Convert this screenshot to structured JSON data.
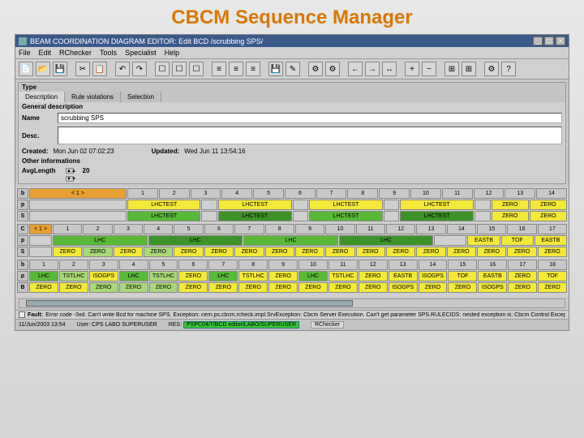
{
  "slide_title": "CBCM Sequence Manager",
  "window": {
    "title": "BEAM COORDINATION DIAGRAM EDITOR:  Edit BCD /scrubbing SPS/",
    "minimize": "_",
    "maximize": "□",
    "close": "×"
  },
  "menubar": [
    "File",
    "Edit",
    "RChecker",
    "Tools",
    "Specialist",
    "Help"
  ],
  "toolbar_icons": [
    "📄",
    "📂",
    "💾",
    "",
    "✂",
    "📋",
    "",
    "↶",
    "↷",
    "",
    "☐",
    "☐",
    "☐",
    "",
    "≡",
    "≡",
    "≡",
    "",
    "💾",
    "✎",
    "",
    "⚙",
    "⚙",
    "",
    "←",
    "→",
    "↔",
    "",
    "+",
    "−",
    "",
    "⊞",
    "⊞",
    "",
    "⚙",
    "?"
  ],
  "type_panel": {
    "header": "Type",
    "tabs": [
      "Description",
      "Rule violations",
      "Selection"
    ],
    "gen_desc": "General description",
    "name_lbl": "Name",
    "name_val": "scrubbing SPS",
    "desc_lbl": "Desc.",
    "desc_val": "",
    "created_lbl": "Created:",
    "created_val": "Mon Jun 02 07:02:23",
    "updated_lbl": "Updated:",
    "updated_val": "Wed Jun 11 13:54:16",
    "other_info": "Other informations",
    "avglen_lbl": "AvgLength",
    "avglen_val": "20"
  },
  "tables": {
    "t1": {
      "rowlabels": [
        "b",
        "p",
        "S"
      ],
      "top_span": "< 1 >",
      "cols": [
        "1",
        "2",
        "3",
        "4",
        "5",
        "6",
        "7",
        "8",
        "9",
        "10",
        "11",
        "12",
        "13",
        "14"
      ],
      "p": [
        "LHCTEST",
        "",
        "LHCTEST",
        "",
        "LHCTEST",
        "",
        "LHCTEST",
        "",
        "ZERO",
        "ZERO"
      ],
      "s": [
        "LHCTEST",
        "",
        "LHCTEST",
        "",
        "LHCTEST",
        "",
        "LHCTEST",
        "",
        "ZERO",
        "ZERO"
      ]
    },
    "t2": {
      "rowlabels": [
        "C",
        "p",
        "S"
      ],
      "top_span": "< 1 >",
      "cols": [
        "1",
        "2",
        "3",
        "4",
        "5",
        "6",
        "7",
        "8",
        "9",
        "10",
        "11",
        "12",
        "13",
        "14",
        "15",
        "16",
        "17"
      ],
      "p": [
        "LHC",
        "",
        "LHC",
        "",
        "LHC",
        "",
        "LHC",
        "",
        "",
        "EASTB",
        "TOF",
        "EASTB"
      ],
      "s": [
        "ZERO",
        "ZERO",
        "ZERO",
        "ZERO",
        "ZERO",
        "ZERO",
        "ZERO",
        "ZERO",
        "ZERO",
        "ZERO",
        "ZERO",
        "ZERO",
        "ZERO",
        "ZERO",
        "ZERO",
        "ZERO",
        "ZERO"
      ]
    },
    "t3": {
      "rowlabels": [
        "b",
        "p",
        "B"
      ],
      "cols": [
        "1",
        "2",
        "3",
        "4",
        "5",
        "6",
        "7",
        "8",
        "9",
        "10",
        "11",
        "12",
        "13",
        "14",
        "15",
        "16",
        "17",
        "18"
      ],
      "p": [
        "LHC",
        "TSTLHC",
        "ISOGPS",
        "LHC",
        "TSTLHC",
        "ZERO",
        "LHC",
        "TSTLHC",
        "ZERO",
        "LHC",
        "TSTLHC",
        "ZERO",
        "EASTB",
        "ISOGPS",
        "TOF",
        "EASTB",
        "ZERO",
        "TOF"
      ],
      "b": [
        "ZERO",
        "ZERO",
        "ZERO",
        "ZERO",
        "ZERO",
        "ZERO",
        "ZERO",
        "ZERO",
        "ZERO",
        "ZERO",
        "ZERO",
        "ZERO",
        "ISOGPS",
        "ZERO",
        "ZERO",
        "ISOGPS",
        "ZERO",
        "ZERO"
      ]
    }
  },
  "fault": {
    "label": "Fault:",
    "msg": "Error code -3xd. Can't write Bcd for machine SPS. Exception: cern.ps.cbcm.rcheck.impl.SrvException: Cbcm Server Execution. Can't get parameter SPS.RULECIDS: nested exception is: Cbcm Control Exception"
  },
  "status": {
    "datetime": "11/Jun/2003 13:54",
    "user_lbl": "User:",
    "user_val": "CPS LABO SUPERUSER",
    "res_lbl": "RES:",
    "res_val": "PSPC04/7/BCD editor/LABO/SUPERUSER",
    "rchk_lbl": "RChecker"
  }
}
